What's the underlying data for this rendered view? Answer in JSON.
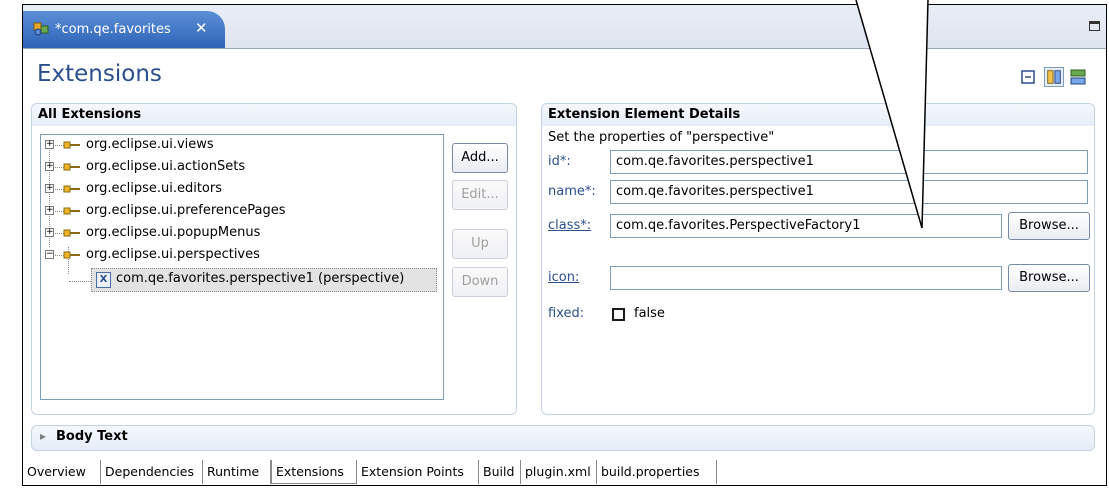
{
  "editor_tab": {
    "label": "*com.qe.favorites",
    "close_glyph": "✕"
  },
  "page_title": "Extensions",
  "all_extensions": {
    "header": "All Extensions",
    "items": [
      {
        "label": "org.eclipse.ui.views",
        "expander": "+"
      },
      {
        "label": "org.eclipse.ui.actionSets",
        "expander": "+"
      },
      {
        "label": "org.eclipse.ui.editors",
        "expander": "+"
      },
      {
        "label": "org.eclipse.ui.preferencePages",
        "expander": "+"
      },
      {
        "label": "org.eclipse.ui.popupMenus",
        "expander": "+"
      },
      {
        "label": "org.eclipse.ui.perspectives",
        "expander": "−"
      }
    ],
    "child": {
      "label": "com.qe.favorites.perspective1 (perspective)",
      "icon_glyph": "X"
    },
    "buttons": {
      "add": "Add...",
      "edit": "Edit...",
      "up": "Up",
      "down": "Down"
    }
  },
  "details": {
    "header": "Extension Element Details",
    "description": "Set the properties of \"perspective\"",
    "id_label": "id*:",
    "id_value": "com.qe.favorites.perspective1",
    "name_label": "name*:",
    "name_value": "com.qe.favorites.perspective1",
    "class_label": "class*:",
    "class_value": "com.qe.favorites.PerspectiveFactory1",
    "icon_label": "icon:",
    "icon_value": "",
    "browse_label": "Browse...",
    "fixed_label": "fixed:",
    "fixed_value": "false"
  },
  "body_text": {
    "arrow": "▸",
    "label": "Body Text"
  },
  "bottom_tabs": [
    "Overview",
    "Dependencies",
    "Runtime",
    "Extensions",
    "Extension Points",
    "Build",
    "plugin.xml",
    "build.properties"
  ],
  "active_tab": "Extensions",
  "icons": [
    "plugin-icon",
    "close-icon",
    "maximize-icon",
    "collapse-all-icon",
    "horizontal-layout-icon",
    "vertical-layout-icon",
    "extension-plug-icon",
    "element-x-icon",
    "expand-arrow-icon"
  ],
  "colors": {
    "title": "#2a4f8c",
    "tab_active": "#3a70c4",
    "section_header": "#e6edf8"
  }
}
